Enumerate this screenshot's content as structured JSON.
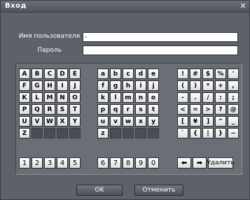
{
  "window": {
    "title": "Вход"
  },
  "form": {
    "username_label": "Имя пользователя",
    "username_value": "-",
    "password_label": "Пароль",
    "password_value": ""
  },
  "keyboard": {
    "upper": [
      "A",
      "B",
      "C",
      "D",
      "E",
      "F",
      "G",
      "H",
      "I",
      "J",
      "K",
      "L",
      "M",
      "N",
      "O",
      "P",
      "Q",
      "R",
      "S",
      "T",
      "U",
      "V",
      "W",
      "X",
      "Y",
      "Z"
    ],
    "lower": [
      "a",
      "b",
      "c",
      "d",
      "e",
      "f",
      "g",
      "h",
      "i",
      "j",
      "k",
      "l",
      "m",
      "n",
      "o",
      "p",
      "q",
      "r",
      "s",
      "t",
      "u",
      "v",
      "w",
      "x",
      "y",
      "z"
    ],
    "symbols": [
      "!",
      "#",
      "$",
      "%",
      "'",
      "(",
      ")",
      "*",
      "+",
      ",",
      "-",
      ".",
      "/",
      ":",
      ";",
      "<",
      "=",
      ">",
      "?",
      "@",
      "[",
      "¥",
      "]",
      "^",
      "_",
      "`",
      "{",
      "|",
      "}",
      "~"
    ],
    "digits_left": [
      "1",
      "2",
      "3",
      "4",
      "5"
    ],
    "digits_right": [
      "6",
      "7",
      "8",
      "9",
      "0"
    ],
    "left_arrow": "⬅",
    "right_arrow": "➡",
    "delete_label": "Удалить"
  },
  "footer": {
    "ok_label": "OK",
    "cancel_label": "Отменить"
  }
}
